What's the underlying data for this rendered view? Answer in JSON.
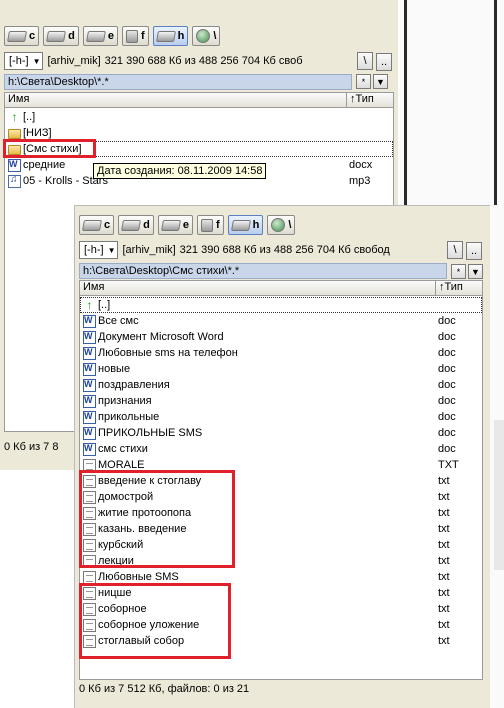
{
  "drives": [
    {
      "letter": "c",
      "icon": "hard-drive-icon"
    },
    {
      "letter": "d",
      "icon": "hard-drive-icon"
    },
    {
      "letter": "e",
      "icon": "hard-drive-icon"
    },
    {
      "letter": "f",
      "icon": "flash-drive-icon"
    },
    {
      "letter": "h",
      "icon": "hard-drive-icon",
      "active": true
    },
    {
      "letter": "\\",
      "icon": "network-icon"
    }
  ],
  "window1": {
    "drive_select": "[-h-]",
    "volume_label": "[arhiv_mik]",
    "free_space": "321 390 688 Кб из 488 256 704 Кб своб",
    "root_button": "\\",
    "up_button": "..",
    "path": "h:\\Света\\Desktop\\*.*",
    "star_button": "*",
    "arrow_button": "▼",
    "col_name": "Имя",
    "col_type": "↑Тип",
    "rows": [
      {
        "name": "[..]",
        "ext": "",
        "icon": "up-arrow-icon"
      },
      {
        "name": "[НИЗ]",
        "ext": "",
        "icon": "folder-icon"
      },
      {
        "name": "[Смс стихи]",
        "ext": "",
        "icon": "folder-icon"
      },
      {
        "name": "средние",
        "ext": "docx",
        "icon": "word-doc-icon"
      },
      {
        "name": "05 - Krolls - Stars",
        "ext": "mp3",
        "icon": "audio-file-icon"
      }
    ],
    "tooltip": "Дата создания: 08.11.2009 14:58",
    "status": "0 Кб из 7 8"
  },
  "window2": {
    "drive_select": "[-h-]",
    "volume_label": "[arhiv_mik]",
    "free_space": "321 390 688 Кб из 488 256 704 Кб свобод",
    "root_button": "\\",
    "up_button": "..",
    "path": "h:\\Света\\Desktop\\Смс стихи\\*.*",
    "star_button": "*",
    "arrow_button": "▼",
    "col_name": "Имя",
    "col_type": "↑Тип",
    "rows": [
      {
        "name": "[..]",
        "ext": "",
        "icon": "up-arrow-icon"
      },
      {
        "name": "Все смс",
        "ext": "doc",
        "icon": "word-doc-icon"
      },
      {
        "name": "Документ Microsoft Word",
        "ext": "doc",
        "icon": "word-doc-icon"
      },
      {
        "name": "Любовные sms на телефон",
        "ext": "doc",
        "icon": "word-doc-icon"
      },
      {
        "name": "новые",
        "ext": "doc",
        "icon": "word-doc-icon"
      },
      {
        "name": "поздравления",
        "ext": "doc",
        "icon": "word-doc-icon"
      },
      {
        "name": "признания",
        "ext": "doc",
        "icon": "word-doc-icon"
      },
      {
        "name": "прикольные",
        "ext": "doc",
        "icon": "word-doc-icon"
      },
      {
        "name": "ПРИКОЛЬНЫЕ SMS",
        "ext": "doc",
        "icon": "word-doc-icon"
      },
      {
        "name": "смс стихи",
        "ext": "doc",
        "icon": "word-doc-icon"
      },
      {
        "name": "MORALE",
        "ext": "TXT",
        "icon": "text-file-icon"
      },
      {
        "name": "введение к стоглаву",
        "ext": "txt",
        "icon": "text-file-icon"
      },
      {
        "name": "домострой",
        "ext": "txt",
        "icon": "text-file-icon"
      },
      {
        "name": "житие протоопопа",
        "ext": "txt",
        "icon": "text-file-icon"
      },
      {
        "name": "казань. введение",
        "ext": "txt",
        "icon": "text-file-icon"
      },
      {
        "name": "курбский",
        "ext": "txt",
        "icon": "text-file-icon"
      },
      {
        "name": "лекции",
        "ext": "txt",
        "icon": "text-file-icon"
      },
      {
        "name": "Любовные SMS",
        "ext": "txt",
        "icon": "text-file-icon"
      },
      {
        "name": "ницше",
        "ext": "txt",
        "icon": "text-file-icon"
      },
      {
        "name": "соборное",
        "ext": "txt",
        "icon": "text-file-icon"
      },
      {
        "name": "соборное уложение",
        "ext": "txt",
        "icon": "text-file-icon"
      },
      {
        "name": "стоглавый собор",
        "ext": "txt",
        "icon": "text-file-icon"
      }
    ],
    "status": "0 Кб из 7 512 Кб, файлов: 0 из 21"
  },
  "colors": {
    "highlight_red": "#e0202a",
    "panel_bg": "#ece9d8",
    "path_bar": "#c9d6ea"
  }
}
